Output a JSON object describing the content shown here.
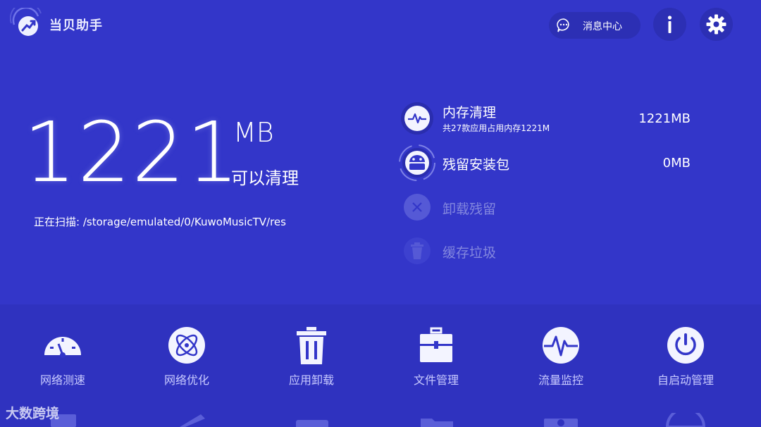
{
  "header": {
    "app_title": "当贝助手",
    "message_center_label": "消息中心",
    "info_label": "i"
  },
  "summary": {
    "amount": "1221",
    "unit": "MB",
    "sub_label": "可以清理",
    "scan_text": "正在扫描: /storage/emulated/0/KuwoMusicTV/res"
  },
  "clean_items": [
    {
      "name": "内存清理",
      "desc": "共27款应用占用内存1221M",
      "value": "1221MB",
      "icon": "pulse-icon"
    },
    {
      "name": "残留安装包",
      "desc": "",
      "value": "0MB",
      "icon": "android-icon"
    },
    {
      "name": "卸载残留",
      "desc": "",
      "value": "",
      "icon": "close-icon"
    },
    {
      "name": "缓存垃圾",
      "desc": "",
      "value": "",
      "icon": "trash-icon"
    }
  ],
  "tools": [
    {
      "label": "网络测速",
      "icon": "speedometer-icon"
    },
    {
      "label": "网络优化",
      "icon": "atom-icon"
    },
    {
      "label": "应用卸载",
      "icon": "trash-can-icon"
    },
    {
      "label": "文件管理",
      "icon": "briefcase-icon"
    },
    {
      "label": "流量监控",
      "icon": "pulse-circle-icon"
    },
    {
      "label": "自启动管理",
      "icon": "power-icon"
    }
  ],
  "watermark": "大数跨境",
  "colors": {
    "background": "#3336c9",
    "bottom_panel": "#2f32bf",
    "button_bg": "#2c2fb4",
    "dim_text": "#8387de",
    "tool_label": "#c9cbff"
  }
}
